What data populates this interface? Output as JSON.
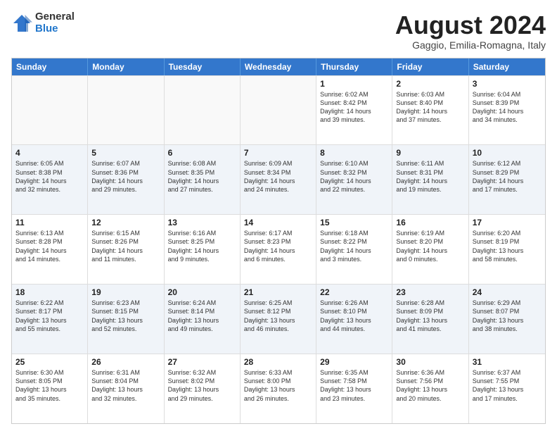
{
  "logo": {
    "general": "General",
    "blue": "Blue"
  },
  "title": "August 2024",
  "location": "Gaggio, Emilia-Romagna, Italy",
  "days": [
    "Sunday",
    "Monday",
    "Tuesday",
    "Wednesday",
    "Thursday",
    "Friday",
    "Saturday"
  ],
  "rows": [
    [
      {
        "day": "",
        "text": "",
        "empty": true
      },
      {
        "day": "",
        "text": "",
        "empty": true
      },
      {
        "day": "",
        "text": "",
        "empty": true
      },
      {
        "day": "",
        "text": "",
        "empty": true
      },
      {
        "day": "1",
        "text": "Sunrise: 6:02 AM\nSunset: 8:42 PM\nDaylight: 14 hours\nand 39 minutes."
      },
      {
        "day": "2",
        "text": "Sunrise: 6:03 AM\nSunset: 8:40 PM\nDaylight: 14 hours\nand 37 minutes."
      },
      {
        "day": "3",
        "text": "Sunrise: 6:04 AM\nSunset: 8:39 PM\nDaylight: 14 hours\nand 34 minutes."
      }
    ],
    [
      {
        "day": "4",
        "text": "Sunrise: 6:05 AM\nSunset: 8:38 PM\nDaylight: 14 hours\nand 32 minutes."
      },
      {
        "day": "5",
        "text": "Sunrise: 6:07 AM\nSunset: 8:36 PM\nDaylight: 14 hours\nand 29 minutes."
      },
      {
        "day": "6",
        "text": "Sunrise: 6:08 AM\nSunset: 8:35 PM\nDaylight: 14 hours\nand 27 minutes."
      },
      {
        "day": "7",
        "text": "Sunrise: 6:09 AM\nSunset: 8:34 PM\nDaylight: 14 hours\nand 24 minutes."
      },
      {
        "day": "8",
        "text": "Sunrise: 6:10 AM\nSunset: 8:32 PM\nDaylight: 14 hours\nand 22 minutes."
      },
      {
        "day": "9",
        "text": "Sunrise: 6:11 AM\nSunset: 8:31 PM\nDaylight: 14 hours\nand 19 minutes."
      },
      {
        "day": "10",
        "text": "Sunrise: 6:12 AM\nSunset: 8:29 PM\nDaylight: 14 hours\nand 17 minutes."
      }
    ],
    [
      {
        "day": "11",
        "text": "Sunrise: 6:13 AM\nSunset: 8:28 PM\nDaylight: 14 hours\nand 14 minutes."
      },
      {
        "day": "12",
        "text": "Sunrise: 6:15 AM\nSunset: 8:26 PM\nDaylight: 14 hours\nand 11 minutes."
      },
      {
        "day": "13",
        "text": "Sunrise: 6:16 AM\nSunset: 8:25 PM\nDaylight: 14 hours\nand 9 minutes."
      },
      {
        "day": "14",
        "text": "Sunrise: 6:17 AM\nSunset: 8:23 PM\nDaylight: 14 hours\nand 6 minutes."
      },
      {
        "day": "15",
        "text": "Sunrise: 6:18 AM\nSunset: 8:22 PM\nDaylight: 14 hours\nand 3 minutes."
      },
      {
        "day": "16",
        "text": "Sunrise: 6:19 AM\nSunset: 8:20 PM\nDaylight: 14 hours\nand 0 minutes."
      },
      {
        "day": "17",
        "text": "Sunrise: 6:20 AM\nSunset: 8:19 PM\nDaylight: 13 hours\nand 58 minutes."
      }
    ],
    [
      {
        "day": "18",
        "text": "Sunrise: 6:22 AM\nSunset: 8:17 PM\nDaylight: 13 hours\nand 55 minutes."
      },
      {
        "day": "19",
        "text": "Sunrise: 6:23 AM\nSunset: 8:15 PM\nDaylight: 13 hours\nand 52 minutes."
      },
      {
        "day": "20",
        "text": "Sunrise: 6:24 AM\nSunset: 8:14 PM\nDaylight: 13 hours\nand 49 minutes."
      },
      {
        "day": "21",
        "text": "Sunrise: 6:25 AM\nSunset: 8:12 PM\nDaylight: 13 hours\nand 46 minutes."
      },
      {
        "day": "22",
        "text": "Sunrise: 6:26 AM\nSunset: 8:10 PM\nDaylight: 13 hours\nand 44 minutes."
      },
      {
        "day": "23",
        "text": "Sunrise: 6:28 AM\nSunset: 8:09 PM\nDaylight: 13 hours\nand 41 minutes."
      },
      {
        "day": "24",
        "text": "Sunrise: 6:29 AM\nSunset: 8:07 PM\nDaylight: 13 hours\nand 38 minutes."
      }
    ],
    [
      {
        "day": "25",
        "text": "Sunrise: 6:30 AM\nSunset: 8:05 PM\nDaylight: 13 hours\nand 35 minutes."
      },
      {
        "day": "26",
        "text": "Sunrise: 6:31 AM\nSunset: 8:04 PM\nDaylight: 13 hours\nand 32 minutes."
      },
      {
        "day": "27",
        "text": "Sunrise: 6:32 AM\nSunset: 8:02 PM\nDaylight: 13 hours\nand 29 minutes."
      },
      {
        "day": "28",
        "text": "Sunrise: 6:33 AM\nSunset: 8:00 PM\nDaylight: 13 hours\nand 26 minutes."
      },
      {
        "day": "29",
        "text": "Sunrise: 6:35 AM\nSunset: 7:58 PM\nDaylight: 13 hours\nand 23 minutes."
      },
      {
        "day": "30",
        "text": "Sunrise: 6:36 AM\nSunset: 7:56 PM\nDaylight: 13 hours\nand 20 minutes."
      },
      {
        "day": "31",
        "text": "Sunrise: 6:37 AM\nSunset: 7:55 PM\nDaylight: 13 hours\nand 17 minutes."
      }
    ]
  ]
}
